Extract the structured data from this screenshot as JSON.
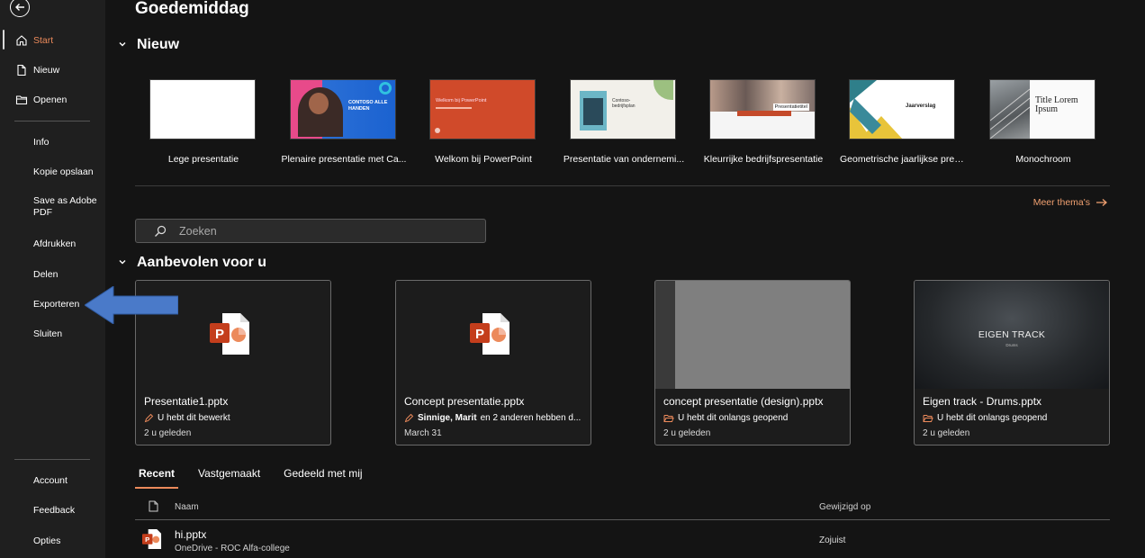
{
  "sidebar": {
    "items_top": [
      {
        "label": "Start",
        "icon": "home-icon"
      },
      {
        "label": "Nieuw",
        "icon": "new-file-icon"
      },
      {
        "label": "Openen",
        "icon": "folder-icon"
      }
    ],
    "items_mid": [
      {
        "label": "Info"
      },
      {
        "label": "Kopie opslaan"
      },
      {
        "label": "Save as Adobe PDF"
      },
      {
        "label": "Afdrukken"
      },
      {
        "label": "Delen"
      },
      {
        "label": "Exporteren"
      },
      {
        "label": "Sluiten"
      }
    ],
    "items_bottom": [
      {
        "label": "Account"
      },
      {
        "label": "Feedback"
      },
      {
        "label": "Opties"
      }
    ]
  },
  "main": {
    "greeting": "Goedemiddag",
    "new_section": "Nieuw",
    "templates": [
      {
        "name": "Lege presentatie"
      },
      {
        "name": "Plenaire presentatie met Ca...",
        "thumb_text": "CONTOSO ALLE HANDEN"
      },
      {
        "name": "Welkom bij PowerPoint",
        "thumb_text": "Welkom bij PowerPoint"
      },
      {
        "name": "Presentatie van ondernemi...",
        "thumb_text": "Contoso-bedrijfsplan"
      },
      {
        "name": "Kleurrijke bedrijfspresentatie",
        "thumb_text": "Presentatietitel"
      },
      {
        "name": "Geometrische jaarlijkse pres...",
        "thumb_text": "Jaarverslag"
      },
      {
        "name": "Monochroom",
        "thumb_text": "Title Lorem Ipsum"
      }
    ],
    "more_themes": "Meer thema's",
    "search_placeholder": "Zoeken",
    "recommended_section": "Aanbevolen voor u",
    "recommended": [
      {
        "title": "Presentatie1.pptx",
        "activity": "U hebt dit bewerkt",
        "activity_bold": "",
        "time": "2 u geleden",
        "activity_icon": "pencil-icon"
      },
      {
        "title": "Concept presentatie.pptx",
        "activity_bold": "Sinnige, Marit",
        "activity": "en 2 anderen hebben d...",
        "time": "March 31",
        "activity_icon": "pencil-icon"
      },
      {
        "title": "concept presentatie (design).pptx",
        "activity": "U hebt dit onlangs geopend",
        "activity_bold": "",
        "time": "2 u geleden",
        "activity_icon": "folder-open-icon"
      },
      {
        "title": "Eigen track - Drums.pptx",
        "activity": "U hebt dit onlangs geopend",
        "activity_bold": "",
        "time": "2 u geleden",
        "activity_icon": "folder-open-icon",
        "thumb_title": "EIGEN TRACK",
        "thumb_sub": "Drums"
      }
    ],
    "tabs": [
      {
        "label": "Recent",
        "active": true
      },
      {
        "label": "Vastgemaakt",
        "active": false
      },
      {
        "label": "Gedeeld met mij",
        "active": false
      }
    ],
    "columns": {
      "name": "Naam",
      "modified": "Gewijzigd op"
    },
    "files": [
      {
        "name": "hi.pptx",
        "location": "OneDrive - ROC Alfa-college",
        "modified": "Zojuist"
      }
    ]
  },
  "colors": {
    "sidebar_bg": "#1f1f1f",
    "main_bg": "#141414",
    "accent": "#ec8a5b",
    "ppt_red": "#c43e1c",
    "arrow_blue": "#4a7ac9"
  }
}
